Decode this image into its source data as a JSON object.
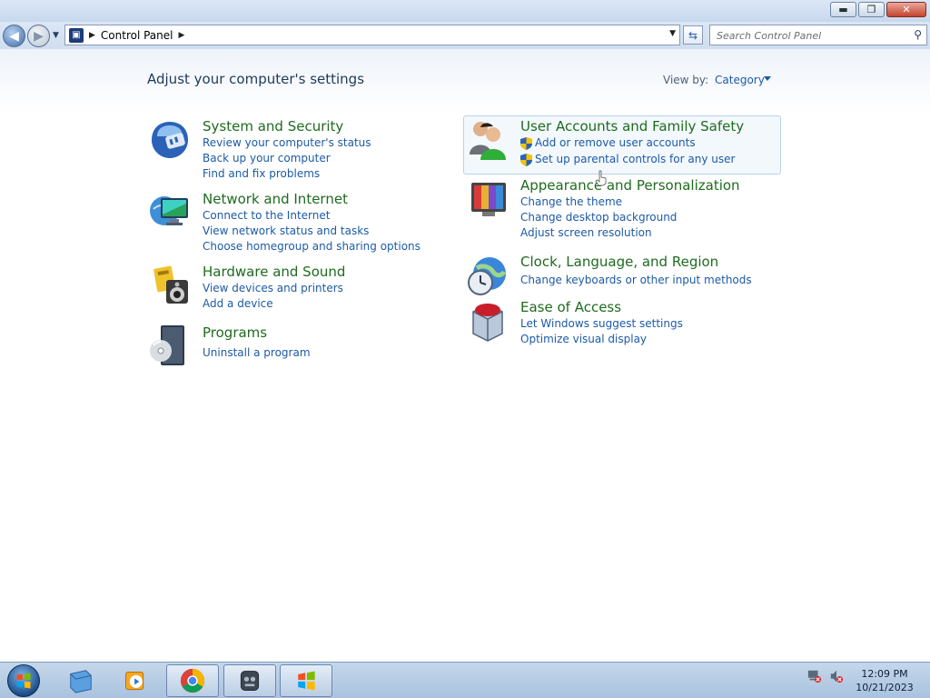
{
  "window": {
    "minimize_glyph": "▬",
    "maximize_glyph": "❐",
    "close_glyph": "✕"
  },
  "address_bar": {
    "path": "Control Panel",
    "search_placeholder": "Search Control Panel"
  },
  "page": {
    "title": "Adjust your computer's settings",
    "view_by_label": "View by:",
    "view_by_value": "Category"
  },
  "categories": [
    {
      "title": "System and Security",
      "icon": "system-security-icon",
      "links": [
        "Review your computer's status",
        "Back up your computer",
        "Find and fix problems"
      ]
    },
    {
      "title": "Network and Internet",
      "icon": "network-internet-icon",
      "links": [
        "Connect to the Internet",
        "View network status and tasks",
        "Choose homegroup and sharing options"
      ]
    },
    {
      "title": "Hardware and Sound",
      "icon": "hardware-sound-icon",
      "links": [
        "View devices and printers",
        "Add a device"
      ]
    },
    {
      "title": "Programs",
      "icon": "programs-icon",
      "links": [
        "Uninstall a program"
      ]
    },
    {
      "title": "User Accounts and Family Safety",
      "icon": "user-accounts-icon",
      "links": [
        "Add or remove user accounts",
        "Set up parental controls for any user"
      ]
    },
    {
      "title": "Appearance and Personalization",
      "icon": "appearance-icon",
      "links": [
        "Change the theme",
        "Change desktop background",
        "Adjust screen resolution"
      ]
    },
    {
      "title": "Clock, Language, and Region",
      "icon": "clock-language-icon",
      "links": [
        "Change keyboards or other input methods"
      ]
    },
    {
      "title": "Ease of Access",
      "icon": "ease-of-access-icon",
      "links": [
        "Let Windows suggest settings",
        "Optimize visual display"
      ]
    }
  ],
  "taskbar": {
    "time": "12:09 PM",
    "date": "10/21/2023"
  },
  "colors": {
    "category_title": "#1e6b1e",
    "link": "#1c5aa6",
    "page_title": "#1e395b"
  }
}
